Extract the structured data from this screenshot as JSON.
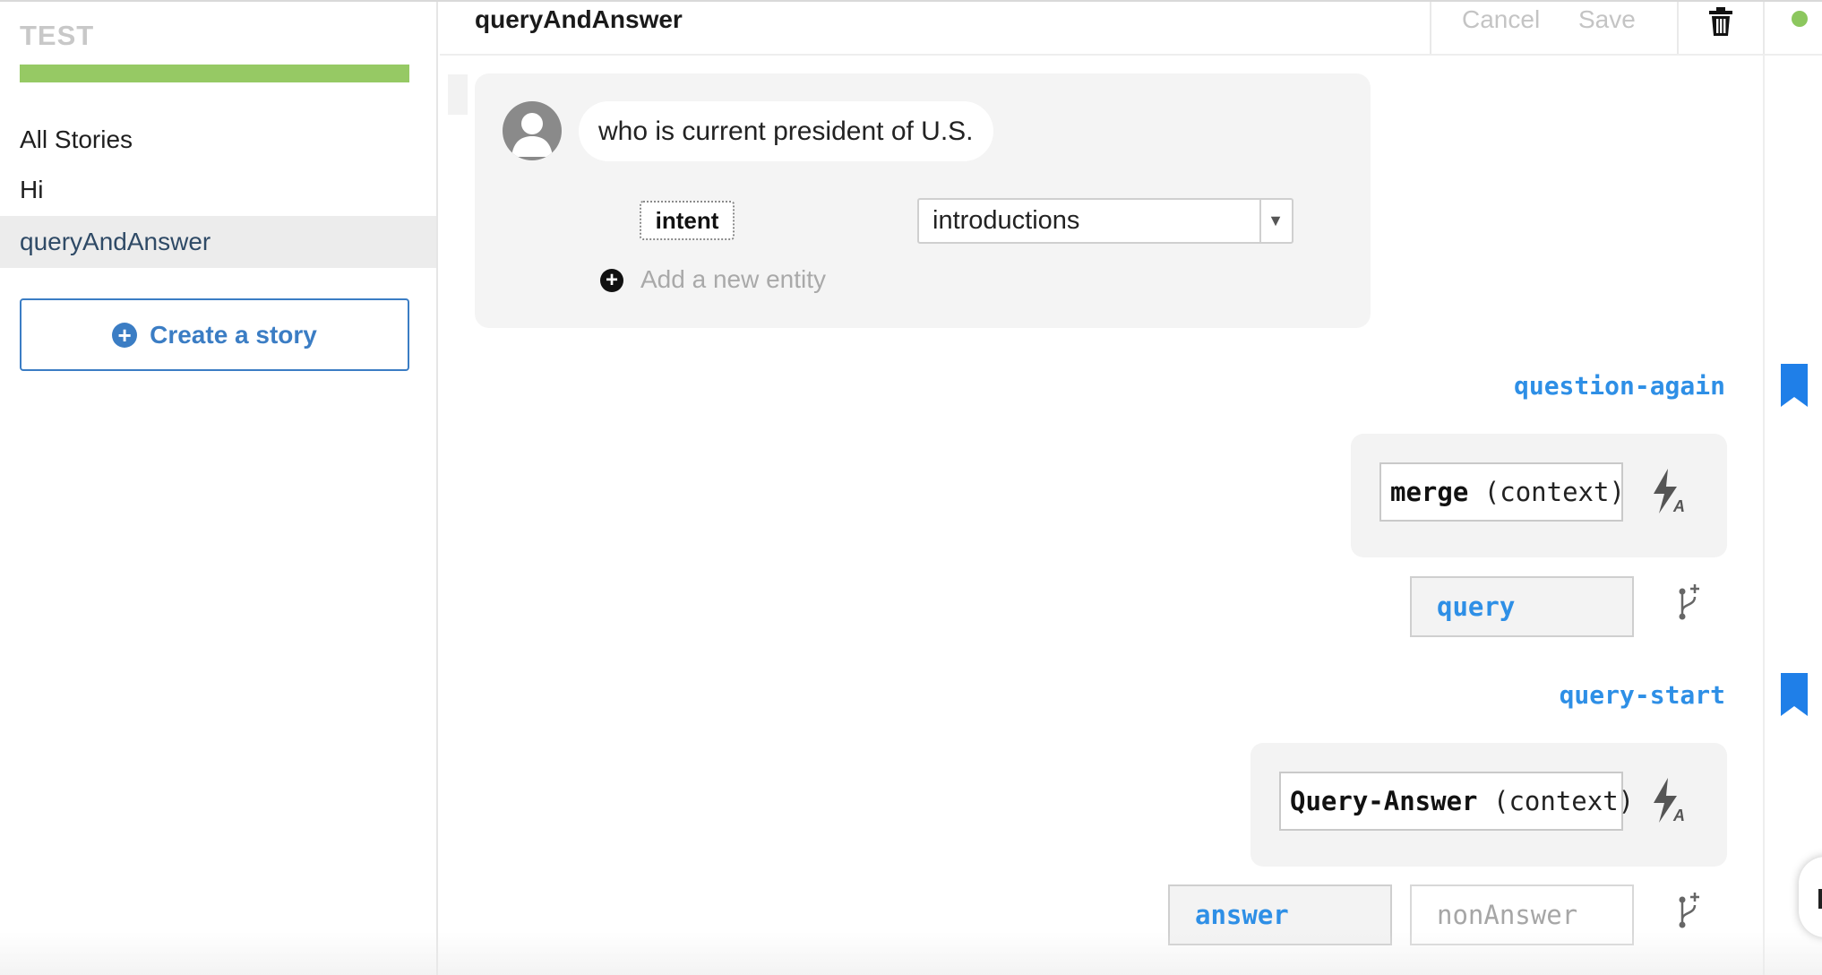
{
  "sidebar": {
    "app_title": "TEST",
    "progress": 1.0,
    "progress_color": "#96c964",
    "all_stories_label": "All Stories",
    "stories": [
      {
        "label": "Hi",
        "selected": false
      },
      {
        "label": "queryAndAnswer",
        "selected": true
      }
    ],
    "create_story_label": "Create a story",
    "create_story_icon": "plus-circle-icon"
  },
  "header": {
    "story_title": "queryAndAnswer",
    "cancel_label": "Cancel",
    "save_label": "Save",
    "delete_icon": "trash-icon",
    "status_icon": "status-dot-icon",
    "status_color": "#8cc75e"
  },
  "user_turn": {
    "avatar_icon": "user-avatar-icon",
    "message": "who is current president of U.S.",
    "entity_label": "intent",
    "entity_value": "introductions",
    "add_entity_icon": "plus-circle-icon",
    "add_entity_placeholder": "Add a new entity"
  },
  "bot_turns": [
    {
      "bookmark": "question-again",
      "bookmark_icon": "bookmark-icon",
      "action_name": "merge",
      "action_args": "(context)",
      "action_icon": "flash-auto-icon",
      "branches": [
        {
          "label": "query",
          "active": true
        }
      ],
      "branch_icon": "add-branch-icon"
    },
    {
      "bookmark": "query-start",
      "bookmark_icon": "bookmark-icon",
      "action_name": "Query-Answer",
      "action_args": "(context)",
      "action_icon": "flash-auto-icon",
      "branches": [
        {
          "label": "answer",
          "active": true
        },
        {
          "label": "nonAnswer",
          "active": false
        }
      ],
      "branch_icon": "add-branch-icon"
    }
  ],
  "colors": {
    "accent_blue": "#2e8fe6",
    "button_blue": "#3b7dc4",
    "card_bg": "#f4f4f4"
  }
}
